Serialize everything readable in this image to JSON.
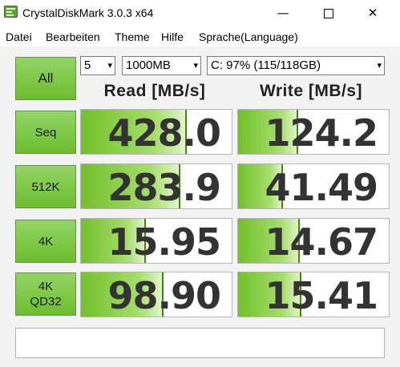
{
  "window": {
    "title": "CrystalDiskMark 3.0.3 x64",
    "minimize_glyph": "—",
    "close_glyph": "✕"
  },
  "menu": [
    "Datei",
    "Bearbeiten",
    "Theme",
    "Hilfe",
    "Sprache(Language)"
  ],
  "controls": {
    "all_label": "All",
    "runs": "5",
    "size": "1000MB",
    "drive": "C: 97% (115/118GB)",
    "dropdown_glyph": "▾"
  },
  "headers": {
    "read": "Read [MB/s]",
    "write": "Write [MB/s]"
  },
  "rows": [
    {
      "label": "Seq",
      "read": "428.0",
      "write": "124.2",
      "read_fill": 0.7,
      "write_fill": 0.4
    },
    {
      "label": "512K",
      "read": "283.9",
      "write": "41.49",
      "read_fill": 0.66,
      "write_fill": 0.3
    },
    {
      "label": "4K",
      "read": "15.95",
      "write": "14.67",
      "read_fill": 0.43,
      "write_fill": 0.41
    },
    {
      "label": "4K\nQD32",
      "read": "98.90",
      "write": "15.41",
      "read_fill": 0.55,
      "write_fill": 0.42
    }
  ],
  "comment": "",
  "colors": {
    "accent_green": "#72c02a",
    "button_green": "#8ed15f"
  }
}
